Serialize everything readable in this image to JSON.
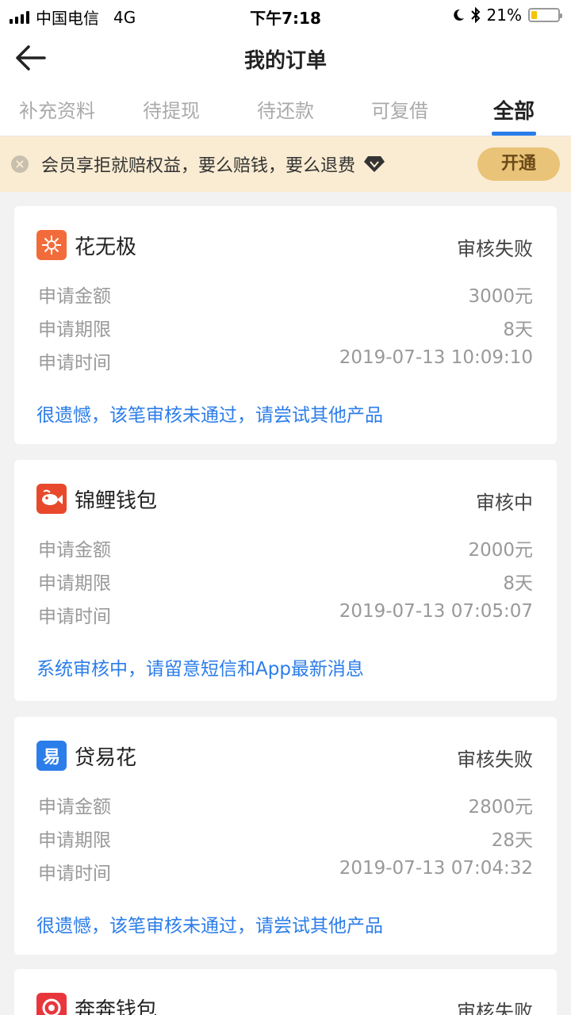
{
  "status_bar": {
    "carrier": "中国电信",
    "network": "4G",
    "time": "下午7:18",
    "battery": "21%",
    "battery_level": 0.21
  },
  "nav": {
    "title": "我的订单",
    "back_icon": "back-arrow-icon"
  },
  "tabs": [
    {
      "label": "补充资料"
    },
    {
      "label": "待提现"
    },
    {
      "label": "待还款"
    },
    {
      "label": "可复借"
    },
    {
      "label": "全部"
    }
  ],
  "banner": {
    "text": "会员享拒就赔权益，要么赔钱，要么退费",
    "button": "开通"
  },
  "orders": [
    {
      "name": "花无极",
      "status": "审核失败",
      "amount_label": "申请金额",
      "amount": "3000元",
      "term_label": "申请期限",
      "term": "8天",
      "time_label": "申请时间",
      "time": "2019-07-13 10:09:10",
      "message": "很遗憾，该笔审核未通过，请尝试其他产品",
      "logo_color": "#f26b3a"
    },
    {
      "name": "锦鲤钱包",
      "status": "审核中",
      "amount_label": "申请金额",
      "amount": "2000元",
      "term_label": "申请期限",
      "term": "8天",
      "time_label": "申请时间",
      "time": "2019-07-13 07:05:07",
      "message": "系统审核中，请留意短信和App最新消息",
      "logo_color": "#e8492c"
    },
    {
      "name": "贷易花",
      "status": "审核失败",
      "amount_label": "申请金额",
      "amount": "2800元",
      "term_label": "申请期限",
      "term": "28天",
      "time_label": "申请时间",
      "time": "2019-07-13 07:04:32",
      "message": "很遗憾，该笔审核未通过，请尝试其他产品",
      "logo_color": "#2b7de9",
      "logo_char": "易"
    },
    {
      "name": "奔奔钱包",
      "status": "审核失败",
      "logo_color": "#e8363d"
    }
  ],
  "colors": {
    "accent": "#2b7de9",
    "banner_bg": "#faecd2",
    "banner_button": "#e9c378"
  }
}
